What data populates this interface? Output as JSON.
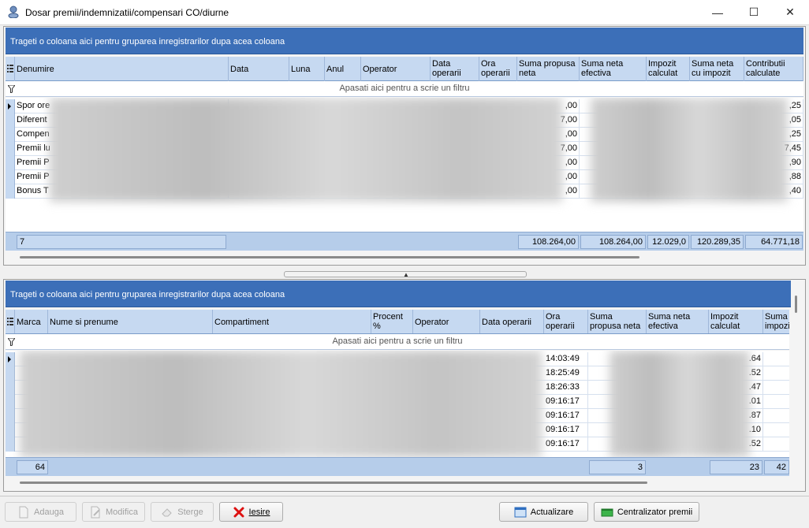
{
  "window": {
    "title": "Dosar premii/indemnizatii/compensari CO/diurne",
    "minimize_glyph": "—",
    "maximize_glyph": "☐",
    "close_glyph": "✕"
  },
  "top_grid": {
    "group_hint": "Trageti o coloana aici pentru gruparea inregistrarilor dupa acea coloana",
    "columns": [
      "Denumire",
      "Data",
      "Luna",
      "Anul",
      "Operator",
      "Data operarii",
      "Ora operarii",
      "Suma propusa neta",
      "Suma neta efectiva",
      "Impozit calculat",
      "Suma neta cu impozit",
      "Contributii calculate"
    ],
    "filter_hint": "Apasati aici pentru a scrie un filtru",
    "rows": [
      {
        "denumire": "Spor ore",
        "suma_propusa": ",00",
        "contributii": ",25"
      },
      {
        "denumire": "Diferent",
        "suma_propusa": "7,00",
        "contributii": ",05"
      },
      {
        "denumire": "Compen",
        "suma_propusa": ",00",
        "contributii": ",25"
      },
      {
        "denumire": "Premii lu",
        "suma_propusa": "7,00",
        "contributii": "7,45"
      },
      {
        "denumire": "Premii P",
        "suma_propusa": ",00",
        "contributii": ",90"
      },
      {
        "denumire": "Premii P",
        "suma_propusa": ",00",
        "contributii": ",88"
      },
      {
        "denumire": "Bonus T",
        "suma_propusa": ",00",
        "contributii": ",40"
      }
    ],
    "footer": {
      "count": "7",
      "suma_propusa": "108.264,00",
      "suma_neta": "108.264,00",
      "impozit": "12.029,0",
      "suma_cu_impozit": "120.289,35",
      "contributii": "64.771,18"
    }
  },
  "bottom_grid": {
    "group_hint": "Trageti o coloana aici pentru gruparea inregistrarilor dupa acea coloana",
    "columns": [
      "Marca",
      "Nume si prenume",
      "Compartiment",
      "Procent %",
      "Operator",
      "Data operarii",
      "Ora operarii",
      "Suma propusa neta",
      "Suma neta efectiva",
      "Impozit calculat",
      "Suma neta impozit"
    ],
    "filter_hint": "Apasati aici pentru a scrie un filtru",
    "rows": [
      {
        "ora": "14:03:49",
        "impozit": ".64"
      },
      {
        "ora": "18:25:49",
        "impozit": ".52"
      },
      {
        "ora": "18:26:33",
        "impozit": ".47"
      },
      {
        "ora": "09:16:17",
        "impozit": ".01"
      },
      {
        "ora": "09:16:17",
        "impozit": ".87"
      },
      {
        "ora": "09:16:17",
        "impozit": ".10"
      },
      {
        "ora": "09:16:17",
        "impozit": ".52"
      }
    ],
    "footer": {
      "count": "64",
      "suma_propusa": "3",
      "impozit": "23",
      "suma_impozit": "42"
    }
  },
  "toolbar": {
    "adauga": "Adauga",
    "modifica": "Modifica",
    "sterge": "Sterge",
    "iesire": "Iesire",
    "actualizare": "Actualizare",
    "centralizator": "Centralizator premii"
  },
  "colors": {
    "group_band": "#3c6fb8",
    "header": "#c6d9f1",
    "footer": "#b6cdea"
  }
}
